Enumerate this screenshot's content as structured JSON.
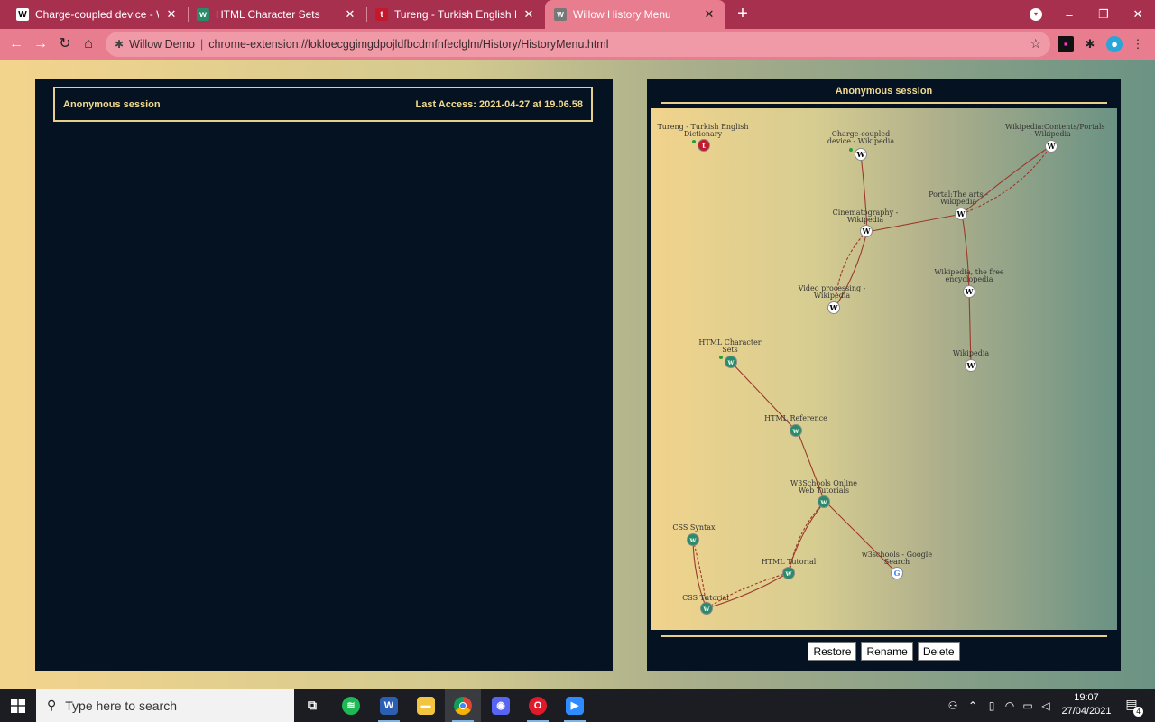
{
  "browser": {
    "tabs": [
      {
        "title": "Charge-coupled device - Wikipedia",
        "favicon": "W",
        "active": false
      },
      {
        "title": "HTML Character Sets",
        "favicon": "w3",
        "active": false
      },
      {
        "title": "Tureng - Turkish English Dictionary",
        "favicon": "t",
        "active": false
      },
      {
        "title": "Willow History Menu",
        "favicon": "W",
        "active": true
      }
    ],
    "new_tab_icon": "plus-icon",
    "window_controls": {
      "minimize": "–",
      "restore": "❐",
      "close": "✕"
    },
    "address_bar": {
      "extension_name": "Willow Demo",
      "url": "chrome-extension://lokloecggimgdpojldfbcdmfnfeclglm/History/HistoryMenu.html"
    },
    "colors": {
      "tabbar": "#a8304f",
      "toolbar": "#e87d8f"
    }
  },
  "left_panel": {
    "session_title": "Anonymous session",
    "last_access": "Last Access: 2021-04-27 at 19.06.58"
  },
  "right_panel": {
    "session_title": "Anonymous session",
    "graph": {
      "nodes": [
        {
          "id": "tureng",
          "label": "Tureng - Turkish English Dictionary",
          "icon": "tureng-icon"
        },
        {
          "id": "ccd",
          "label": "Charge-coupled device - Wikipedia",
          "icon": "wikipedia-icon"
        },
        {
          "id": "contents",
          "label": "Wikipedia:Contents/Portals - Wikipedia",
          "icon": "wikipedia-icon"
        },
        {
          "id": "arts",
          "label": "Portal:The arts - Wikipedia",
          "icon": "wikipedia-icon"
        },
        {
          "id": "cine",
          "label": "Cinematography - Wikipedia",
          "icon": "wikipedia-icon"
        },
        {
          "id": "free",
          "label": "Wikipedia, the free encyclopedia",
          "icon": "wikipedia-icon"
        },
        {
          "id": "video",
          "label": "Video processing - Wikipedia",
          "icon": "wikipedia-icon"
        },
        {
          "id": "wiki",
          "label": "Wikipedia",
          "icon": "wikipedia-icon"
        },
        {
          "id": "htmlchar",
          "label": "HTML Character Sets",
          "icon": "w3schools-icon"
        },
        {
          "id": "htmlref",
          "label": "HTML Reference",
          "icon": "w3schools-icon"
        },
        {
          "id": "w3home",
          "label": "W3Schools Online Web Tutorials",
          "icon": "w3schools-icon"
        },
        {
          "id": "csssyntax",
          "label": "CSS Syntax",
          "icon": "w3schools-icon"
        },
        {
          "id": "htmltut",
          "label": "HTML Tutorial",
          "icon": "w3schools-icon"
        },
        {
          "id": "google",
          "label": "w3schools - Google Search",
          "icon": "google-icon"
        },
        {
          "id": "csstut",
          "label": "CSS Tutorial",
          "icon": "w3schools-icon"
        }
      ],
      "edge_color": "#9a3a2a"
    },
    "buttons": {
      "restore": "Restore",
      "rename": "Rename",
      "delete": "Delete"
    }
  },
  "taskbar": {
    "search_placeholder": "Type here to search",
    "apps": [
      "task-view",
      "spotify",
      "word",
      "file-explorer",
      "chrome",
      "discord",
      "opera",
      "zoom"
    ],
    "time": "19:07",
    "date": "27/04/2021",
    "notification_count": "4"
  }
}
